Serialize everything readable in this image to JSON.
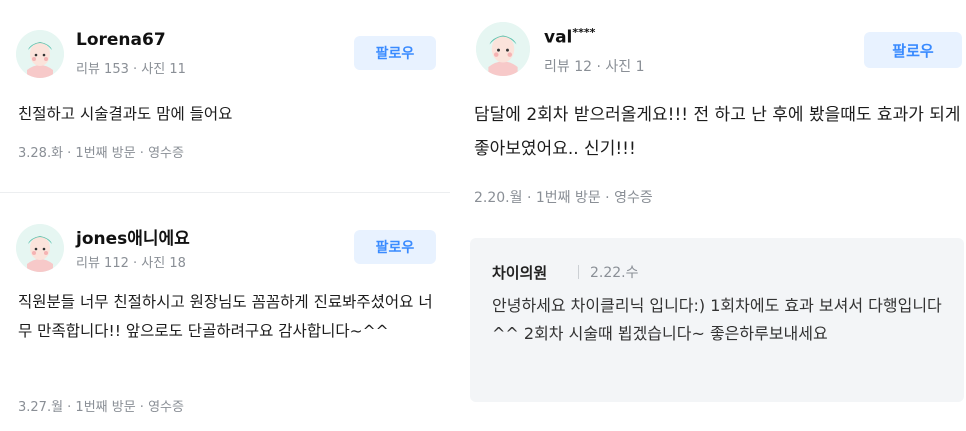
{
  "left_reviews": [
    {
      "username": "Lorena67",
      "meta": "리뷰 153 · 사진 11",
      "follow_label": "팔로우",
      "text": "친절하고 시술결과도 맘에 들어요",
      "info": "3.28.화 · 1번째 방문 · 영수증"
    },
    {
      "username": "jones애니에요",
      "meta": "리뷰 112 · 사진 18",
      "follow_label": "팔로우",
      "text": "직원분들 너무 친절하시고 원장님도 꼼꼼하게 진료봐주셨어요 너무 만족합니다!! 앞으로도 단골하려구요 감사합니다~^^",
      "info": "3.27.월 · 1번째 방문 · 영수증"
    }
  ],
  "right_review": {
    "username": "val",
    "username_mask": "****",
    "meta": "리뷰 12 · 사진 1",
    "follow_label": "팔로우",
    "text": "담달에 2회차 받으러올게요!!! 전 하고 난 후에 봤을때도 효과가 되게 좋아보였어요.. 신기!!!",
    "info": "2.20.월 · 1번째 방문 · 영수증",
    "reply": {
      "owner": "차이의원",
      "date": "2.22.수",
      "text": "안녕하세요 차이클리닉 입니다:) 1회차에도 효과 보셔서 다행입니다^^ 2회차 시술때 뵙겠습니다~ 좋은하루보내세요"
    }
  },
  "colors": {
    "follow_bg": "#e8f2ff",
    "follow_text": "#3a8bff",
    "reply_bg": "#f3f5f7",
    "meta_text": "#8a8f96"
  },
  "icons": {
    "avatar": "profile-avatar-icon"
  }
}
